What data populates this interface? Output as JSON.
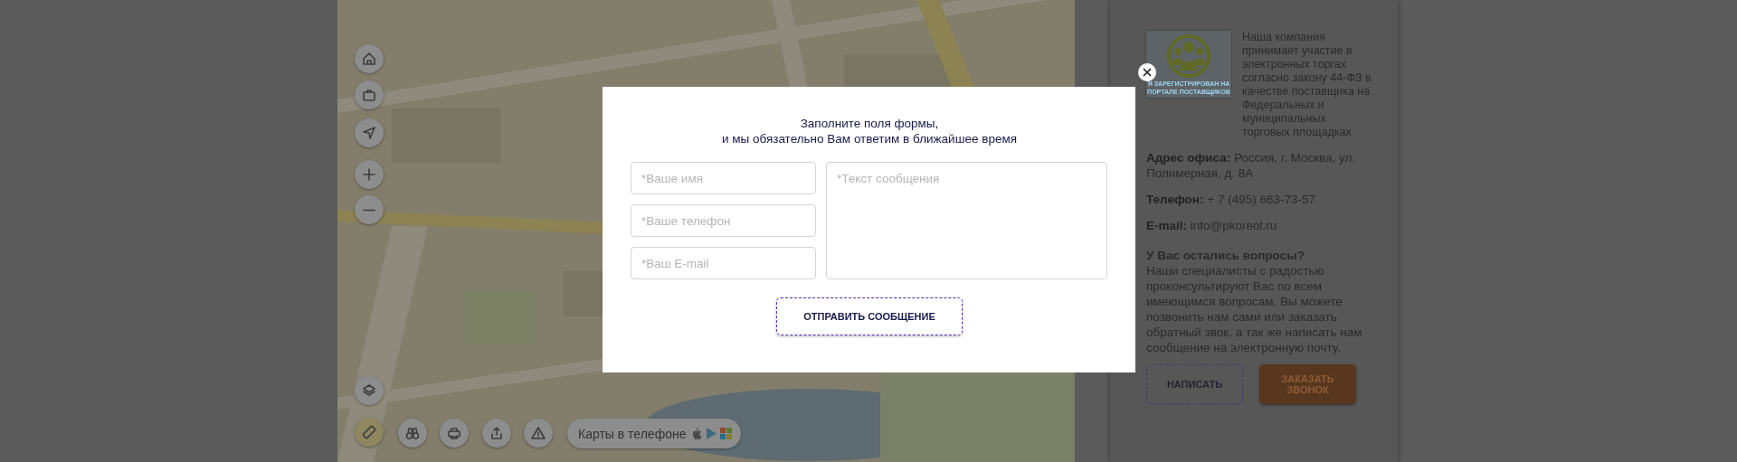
{
  "map": {
    "ruler_active": true,
    "app_promo": "Карты в телефоне"
  },
  "modal": {
    "title": "Заполните поля  формы,\nи мы обязательно Вам ответим в ближайшее время",
    "fields": [
      {
        "placeholder": "*Ваше имя"
      },
      {
        "placeholder": "*Ваше телефон"
      },
      {
        "placeholder": "*Ваш E-mail"
      }
    ],
    "message": {
      "placeholder": "*Текст сообщения"
    },
    "submit": "ОТПРАВИТЬ СООБЩЕНИЕ"
  },
  "contacts": {
    "badge_caption": "Я ЗАРЕГИСТРИРОВАН НА\nПОРТАЛЕ ПОСТАВЩИКОВ",
    "intro": "Наша компания принимает участие в электронных торгах согласно закону 44-ФЗ в качестве поставщика  на Федеральных и муниципальных торговых площадках",
    "details": [
      "**Адрес офиса:** Россия, г. Москва, ул. Полимерная, д. 8А",
      "**Телефон:** + 7 (495) 663-73-57",
      "**E-mail:** info@pkoreol.ru"
    ],
    "questions": {
      "title": "У Вас остались вопросы?",
      "text": "Наши специалисты с радостью проконсультируют Вас по всем имеющимся вопросам. Вы можете позвонить нам сами или заказать обратный звок, а так же написать нам сообщение на электронную почту."
    },
    "buttons": [
      {
        "kind": "outline",
        "label": "НАПИСАТЬ"
      },
      {
        "kind": "filled",
        "label": "ЗАКАЗАТЬ ЗВОНОК"
      }
    ]
  }
}
